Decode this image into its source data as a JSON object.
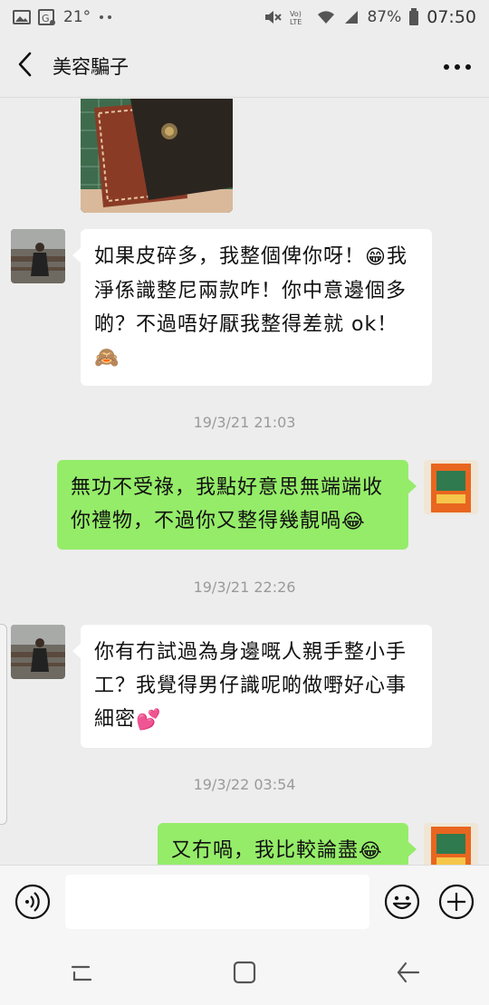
{
  "status_bar": {
    "temperature": "21°",
    "battery": "87%",
    "time": "07:50",
    "left_icons": [
      "image-icon",
      "location-icon",
      "dots-icon"
    ],
    "right_icons": [
      "mute-icon",
      "volte-icon",
      "wifi-icon",
      "signal-icon",
      "battery-icon"
    ]
  },
  "header": {
    "title": "美容騙子",
    "back_icon": "chevron-left-icon",
    "more_icon": "more-horizontal-icon"
  },
  "messages": [
    {
      "type": "image",
      "side": "left",
      "description_icon": "leather-wallet-photo"
    },
    {
      "type": "text",
      "side": "left",
      "lines": [
        "如果皮碎多，我整個俾你呀！",
        "淨係識整尼兩款咋！你中意邊個多",
        "啲？不過唔好厭我整得差就 ok！"
      ],
      "emoji_end_first": "😁",
      "emoji_end_first_suffix": "我",
      "trailing_emoji": "🙈"
    },
    {
      "type": "timestamp",
      "text": "19/3/21 21:03"
    },
    {
      "type": "text",
      "side": "right",
      "lines": [
        "無功不受祿，我點好意思無端端收",
        "你禮物，不過你又整得幾靚喎"
      ],
      "trailing_emoji": "😂"
    },
    {
      "type": "timestamp",
      "text": "19/3/21 22:26"
    },
    {
      "type": "text",
      "side": "left",
      "lines": [
        "你有冇試過為身邊嘅人親手整小手",
        "工？我覺得男仔識呢啲做嘢好心事",
        "細密"
      ],
      "trailing_emoji": "💕"
    },
    {
      "type": "timestamp",
      "text": "19/3/22 03:54"
    },
    {
      "type": "text",
      "side": "right",
      "lines": [
        "又冇喎，我比較論盡"
      ],
      "trailing_emoji": "😂"
    }
  ],
  "input_bar": {
    "value": "",
    "placeholder": "",
    "voice_icon": "voice-icon",
    "emoji_icon": "smiley-icon",
    "plus_icon": "plus-circle-icon"
  },
  "system_nav": [
    "recents-icon",
    "home-icon",
    "back-icon"
  ],
  "colors": {
    "bg": "#ededed",
    "sent_bubble": "#95ec69",
    "received_bubble": "#ffffff",
    "timestamp": "#9a9a9a"
  }
}
